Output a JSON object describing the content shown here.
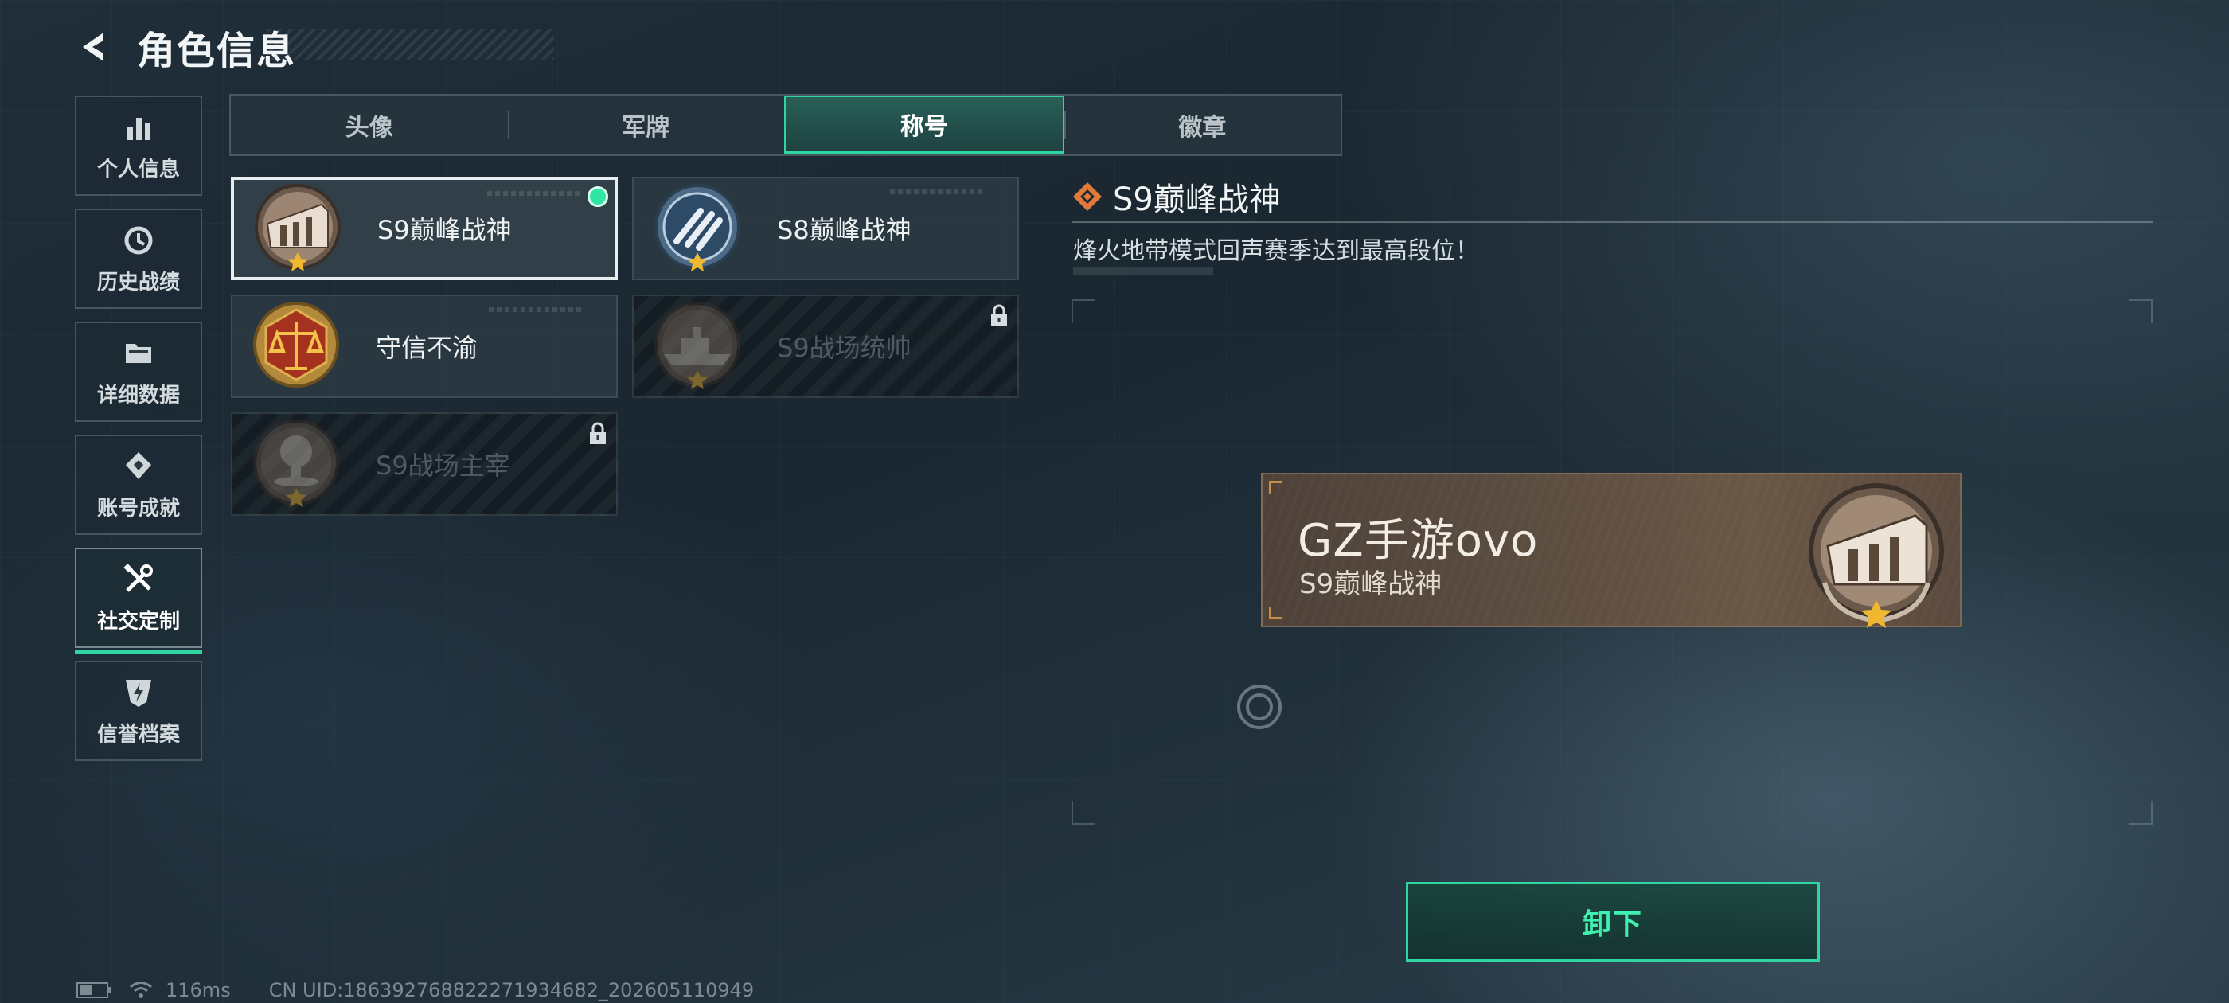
{
  "header": {
    "title": "角色信息"
  },
  "sidebar": {
    "items": [
      {
        "label": "个人信息",
        "icon": "bar-chart-icon"
      },
      {
        "label": "历史战绩",
        "icon": "history-icon"
      },
      {
        "label": "详细数据",
        "icon": "folder-icon"
      },
      {
        "label": "账号成就",
        "icon": "achievement-icon"
      },
      {
        "label": "社交定制",
        "icon": "tools-icon",
        "active": true
      },
      {
        "label": "信誉档案",
        "icon": "shield-icon"
      }
    ]
  },
  "tabs": [
    {
      "label": "头像"
    },
    {
      "label": "军牌"
    },
    {
      "label": "称号",
      "active": true
    },
    {
      "label": "徽章"
    }
  ],
  "titles": [
    {
      "name": "S9巅峰战神",
      "state": "equipped"
    },
    {
      "name": "S8巅峰战神",
      "state": "owned"
    },
    {
      "name": "守信不渝",
      "state": "owned"
    },
    {
      "name": "S9战场统帅",
      "state": "locked"
    },
    {
      "name": "S9战场主宰",
      "state": "locked"
    }
  ],
  "detail": {
    "title": "S9巅峰战神",
    "description": "烽火地带模式回声赛季达到最高段位！"
  },
  "nameplate": {
    "player_name": "GZ手游ovo",
    "title": "S9巅峰战神"
  },
  "actions": {
    "unequip_label": "卸下"
  },
  "footer": {
    "ping": "116ms",
    "uid": "CN UID:186392768822271934682_202605110949"
  },
  "colors": {
    "accent": "#2fd6a1",
    "equipped_dot": "#2fe6a4",
    "title_icon": "#e07a3a",
    "nameplate_bg": "#5c4d41"
  }
}
